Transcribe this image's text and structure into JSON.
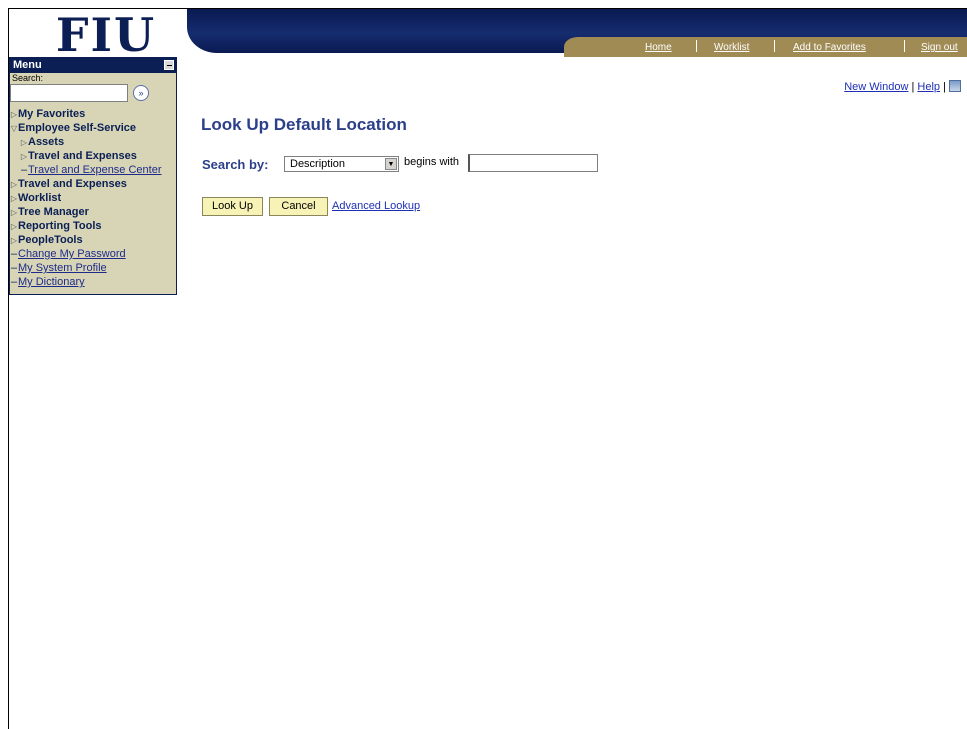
{
  "header": {
    "logo_text": "FIU",
    "nav": {
      "home": "Home",
      "worklist": "Worklist",
      "add_favorites": "Add to Favorites",
      "sign_out": "Sign out"
    }
  },
  "menu": {
    "title": "Menu",
    "search_label": "Search:",
    "search_value": "",
    "go_glyph": "»",
    "items": [
      {
        "label": "My Favorites"
      },
      {
        "label": "Employee Self-Service"
      },
      {
        "label": "Assets"
      },
      {
        "label": "Travel and Expenses"
      },
      {
        "label": "Travel and Expense Center"
      },
      {
        "label": "Travel and Expenses"
      },
      {
        "label": "Worklist"
      },
      {
        "label": "Tree Manager"
      },
      {
        "label": "Reporting Tools"
      },
      {
        "label": "PeopleTools"
      },
      {
        "label": "Change My Password"
      },
      {
        "label": "My System Profile"
      },
      {
        "label": "My Dictionary"
      }
    ]
  },
  "top_links": {
    "new_window": "New Window",
    "help": "Help",
    "separator": "|"
  },
  "main": {
    "title": "Look Up Default Location",
    "search_by_label": "Search by:",
    "search_field_selected": "Description",
    "operator_text": "begins with",
    "criteria_value": "",
    "lookup_button": "Look Up",
    "cancel_button": "Cancel",
    "advanced_link": "Advanced Lookup"
  },
  "colors": {
    "brand_navy": "#0b1f55",
    "nav_gold": "#a08b55",
    "menu_bg": "#d7d5b6",
    "title_blue": "#2b3f8a",
    "button_bg": "#f7f3b7",
    "link_blue": "#1e2fb4"
  }
}
